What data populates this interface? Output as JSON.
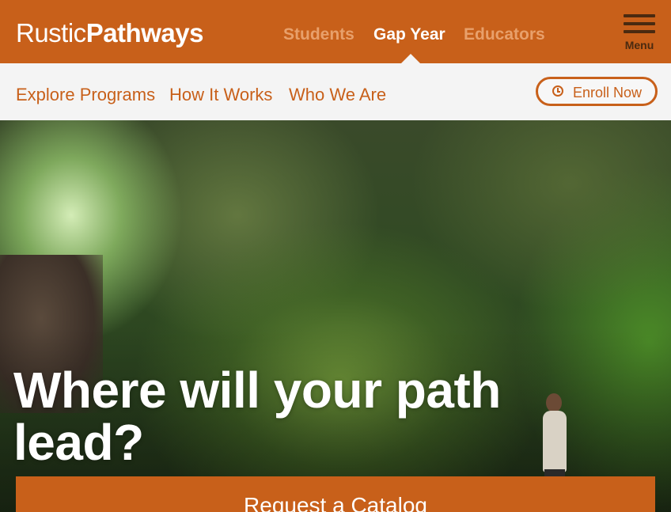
{
  "brand": {
    "light": "Rustic",
    "bold": "Pathways"
  },
  "audience_tabs": [
    {
      "label": "Students",
      "active": false
    },
    {
      "label": "Gap Year",
      "active": true
    },
    {
      "label": "Educators",
      "active": false
    }
  ],
  "menu": {
    "label": "Menu"
  },
  "subnav": {
    "links": [
      "Explore Programs",
      "How It Works",
      "Who We Are"
    ],
    "enroll_label": "Enroll Now"
  },
  "hero": {
    "headline": "Where will your path lead?",
    "cta_label": "Request a Catalog"
  },
  "colors": {
    "brand_orange": "#c8601a",
    "inactive_tab": "#e8a06b",
    "subnav_bg": "#f4f4f4"
  },
  "icons": {
    "menu": "hamburger-icon",
    "enroll": "clock-icon"
  }
}
